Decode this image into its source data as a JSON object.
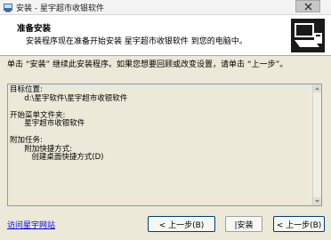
{
  "window": {
    "title": "安装 - 星宇超市收银软件"
  },
  "header": {
    "title": "准备安装",
    "subtitle": "安装程序现在准备开始安装 星宇超市收银软件 到您的电脑中。"
  },
  "instruction": "单击 “安装” 继续此安装程序。如果您想要回顾或改变设置，请单击 “上一步”。",
  "summary": {
    "lines": [
      "目标位置:",
      "      d:\\星宇软件\\星宇超市收银软件",
      "",
      "开始菜单文件夹:",
      "      星宇超市收银软件",
      "",
      "附加任务:",
      "      附加快捷方式:",
      "         创建桌面快捷方式(D)"
    ]
  },
  "footer": {
    "link": "访问星宇网站",
    "back": "< 上一步(B)",
    "install": "|安装",
    "cancel": "< 上一步(B)"
  }
}
